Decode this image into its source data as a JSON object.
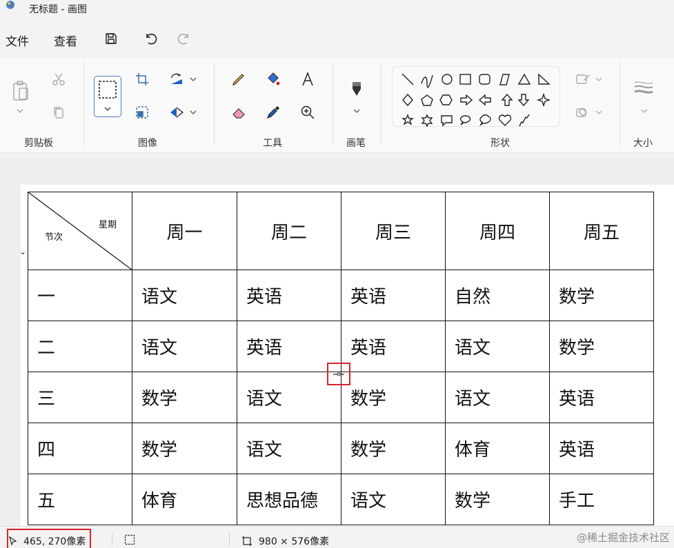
{
  "titlebar": {
    "title": "无标题 - 画图",
    "icon": "paint-app-icon"
  },
  "menubar": {
    "file": "文件",
    "view": "查看",
    "buttons": [
      "save-icon",
      "undo-icon",
      "redo-icon"
    ]
  },
  "ribbon": {
    "groups": {
      "clipboard": "剪贴板",
      "image": "图像",
      "tools": "工具",
      "brushes": "画笔",
      "shapes": "形状",
      "size": "大小"
    }
  },
  "table": {
    "corner": {
      "top": "星期",
      "bottom": "节次"
    },
    "days": [
      "周一",
      "周二",
      "周三",
      "周四",
      "周五"
    ],
    "rows": [
      {
        "period": "一",
        "cells": [
          "语文",
          "英语",
          "英语",
          "自然",
          "数学"
        ]
      },
      {
        "period": "二",
        "cells": [
          "语文",
          "英语",
          "英语",
          "语文",
          "数学"
        ]
      },
      {
        "period": "三",
        "cells": [
          "数学",
          "语文",
          "数学",
          "语文",
          "英语"
        ]
      },
      {
        "period": "四",
        "cells": [
          "数学",
          "语文",
          "数学",
          "体育",
          "英语"
        ]
      },
      {
        "period": "五",
        "cells": [
          "体育",
          "思想品德",
          "语文",
          "数学",
          "手工"
        ]
      }
    ]
  },
  "statusbar": {
    "position": "465, 270像素",
    "image_size": "980 × 576像素",
    "watermark": "@稀土掘金技术社区"
  },
  "colors": {
    "highlight": "#d9232e",
    "accent": "#4a7dbb"
  }
}
